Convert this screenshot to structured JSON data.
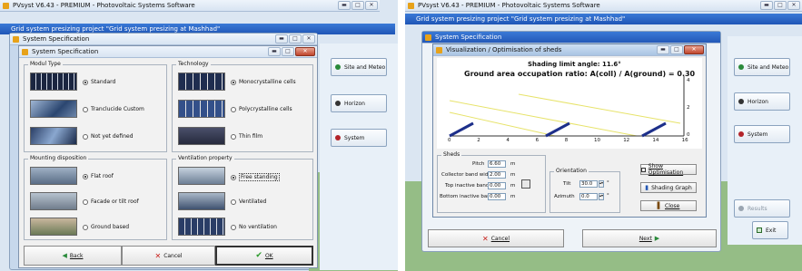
{
  "left": {
    "app_title": "PVsyst V6.43 - PREMIUM - Photovoltaic Systems Software",
    "project_title": "Grid system presizing project  \"Grid system presizing  at  Mashhad\"",
    "dialog_title": "System Specification",
    "subdialog_title": "System Specification",
    "modul_type": {
      "title": "Modul Type",
      "options": [
        "Standard",
        "Tranclucide Custom",
        "Not yet defined"
      ],
      "selected": 0
    },
    "technology": {
      "title": "Technology",
      "options": [
        "Monocrystalline cells",
        "Polycrystalline cells",
        "Thin film"
      ],
      "selected": 0
    },
    "mounting": {
      "title": "Mounting disposition",
      "options": [
        "Flat roof",
        "Facade or tilt roof",
        "Ground based"
      ],
      "selected": 0
    },
    "ventilation": {
      "title": "Ventilation property",
      "options": [
        "Free standing",
        "Ventilated",
        "No ventilation"
      ],
      "selected": 0
    },
    "side_buttons": [
      "Site and Meteo",
      "Horizon",
      "System"
    ],
    "back": "Back",
    "cancel": "Cancel",
    "ok": "OK"
  },
  "right": {
    "app_title": "PVsyst V6.43 - PREMIUM - Photovoltaic Systems Software",
    "project_title": "Grid system presizing project  \"Grid system presizing  at  Mashhad\"",
    "dialog_title": "System Specification",
    "viz_title": "Visualization / Optimisation of sheds",
    "shading_limit": "Shading limit angle:  11.6°",
    "gcr": "Ground area occupation ratio:  A(coll) / A(ground) = 0.30",
    "x_ticks": [
      "0",
      "2",
      "4",
      "6",
      "8",
      "10",
      "12",
      "14",
      "16"
    ],
    "y_ticks": [
      "0",
      "2",
      "4"
    ],
    "sheds_title": "Sheds",
    "pitch_label": "Pitch",
    "pitch_value": "6.60",
    "pitch_unit": "m",
    "cbw_label": "Collector band width",
    "cbw_value": "2.00",
    "cbw_unit": "m",
    "top_label": "Top inactive band",
    "top_value": "0.00",
    "top_unit": "m",
    "bottom_label": "Bottom inactive band",
    "bottom_value": "0.00",
    "bottom_unit": "m",
    "orientation_title": "Orientation",
    "tilt_label": "Tilt",
    "tilt_value": "30.0",
    "azimuth_label": "Azimuth",
    "azimuth_value": "0.0",
    "deg": "°",
    "show_opt": "Show Optimisation",
    "shading_graph": "Shading Graph",
    "close": "Close",
    "side_buttons": [
      "Site and Meteo",
      "Horizon",
      "System"
    ],
    "results": "Results",
    "exit": "Exit",
    "cancel": "Cancel",
    "next": "Next"
  }
}
